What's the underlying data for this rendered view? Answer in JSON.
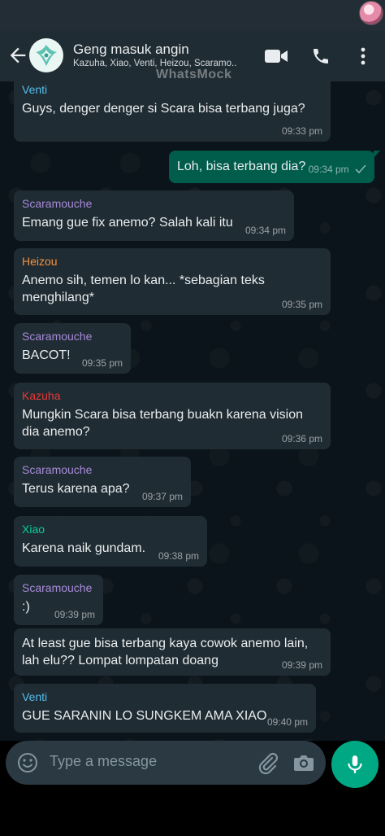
{
  "header": {
    "group_name": "Geng masuk angin",
    "members": "Kazuha, Xiao, Venti, Heizou, Scaramo..",
    "watermark": "WhatsMock"
  },
  "icons": {
    "back": "arrow-left-icon",
    "video": "video-call-icon",
    "phone": "phone-icon",
    "menu": "more-vert-icon",
    "emoji": "emoji-icon",
    "attach": "paperclip-icon",
    "camera": "camera-icon",
    "mic": "mic-icon"
  },
  "colors": {
    "header_bg": "#202c33",
    "incoming_bubble": "#202c33",
    "outgoing_bubble": "#005c4b",
    "accent": "#00a884"
  },
  "messages": [
    {
      "sender": "Venti",
      "sender_color": "#53bdeb",
      "text": "Guys, denger denger si Scara bisa terbang juga?",
      "time": "09:33 pm"
    },
    {
      "outgoing": true,
      "text": "Loh, bisa terbang dia?",
      "time": "09:34 pm"
    },
    {
      "sender": "Scaramouche",
      "sender_color": "#a78bda",
      "text": "Emang gue fix anemo? Salah kali itu",
      "time": "09:34 pm"
    },
    {
      "sender": "Heizou",
      "sender_color": "#f7923b",
      "text": "Anemo sih, temen lo kan... *sebagian teks menghilang*",
      "time": "09:35 pm"
    },
    {
      "sender": "Scaramouche",
      "sender_color": "#a78bda",
      "text": "BACOT!",
      "time": "09:35 pm"
    },
    {
      "sender": "Kazuha",
      "sender_color": "#e53935",
      "text": "Mungkin Scara bisa terbang buakn karena vision dia anemo?",
      "time": "09:36 pm"
    },
    {
      "sender": "Scaramouche",
      "sender_color": "#a78bda",
      "text": "Terus karena apa?",
      "time": "09:37 pm"
    },
    {
      "sender": "Xiao",
      "sender_color": "#06cf9c",
      "text": "Karena naik gundam.",
      "time": "09:38 pm"
    },
    {
      "sender": "Scaramouche",
      "sender_color": "#a78bda",
      "text": ":)",
      "time": "09:39 pm"
    },
    {
      "text": "At least gue bisa terbang kaya cowok anemo lain, lah elu?? Lompat lompatan doang",
      "time": "09:39 pm"
    },
    {
      "sender": "Venti",
      "sender_color": "#53bdeb",
      "text": "GUE SARANIN LO SUNGKEM AMA XIAO",
      "time": "09:40 pm"
    }
  ],
  "composer": {
    "placeholder": "Type a message"
  }
}
